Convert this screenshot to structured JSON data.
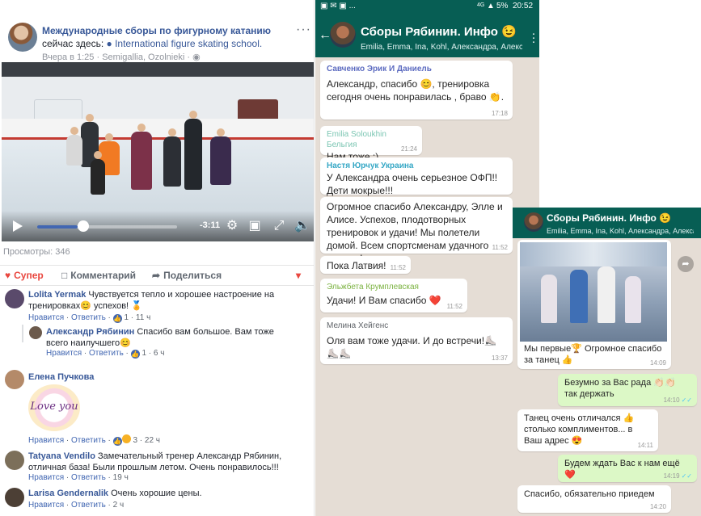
{
  "facebook": {
    "post": {
      "page_name": "Международные сборы по фигурному катанию",
      "time_inline": "сейчас",
      "here_prefix": "здесь:",
      "location": "International figure skating school.",
      "date": "Вчера в 1:25",
      "place": "Semigallia, Ozolnieki",
      "privacy_icon": "globe-icon"
    },
    "video": {
      "time_remaining": "-3:11",
      "progress": 0.29
    },
    "views": "Просмотры: 346",
    "actions": {
      "like": "Супер",
      "comment": "Комментарий",
      "share": "Поделиться"
    },
    "comments": [
      {
        "author": "Lolita Yermak",
        "text": "Чувствуется тепло и хорошее настроение на тренировках😊 успехов! 🏅",
        "reply": "Ответить",
        "likes": "1",
        "time": "11 ч",
        "reply_item": {
          "author": "Александр Рябинин",
          "text": "Спасибо вам большое. Вам тоже всего наилучшего😊",
          "like_label": "Нравится",
          "reply": "Ответить",
          "likes": "1",
          "time": "6 ч"
        }
      },
      {
        "author": "Елена Пучкова",
        "sticker_text": "Love you",
        "reply": "Ответить",
        "likes": "3",
        "time": "22 ч"
      },
      {
        "author": "Tatyana Vendilo",
        "text": "Замечательный тренер Александр Рябинин, отличная база! Были прошлым летом. Очень понравилось!!!",
        "reply": "Ответить",
        "time": "19 ч"
      },
      {
        "author": "Larisa Gendernalik",
        "text": "Очень хорошие цены.",
        "reply": "Ответить",
        "time": "2 ч"
      }
    ],
    "like_label": "Нравится"
  },
  "whatsapp_main": {
    "status": {
      "battery": "5%",
      "time": "20:52",
      "network": "4G"
    },
    "title": "Сборы Рябинин. Инфо 😉",
    "members": "Emilia, Emma, Ina, Kohl, Александра, Александр...",
    "messages": [
      {
        "sender": "Савченко Эрик И Даниель",
        "sender_color": "#5c6bc0",
        "text": "Александр, спасибо 😊, тренировка сегодня очень понравилась , браво 👏.",
        "time": "17:18"
      },
      {
        "sender": "Emilia Soloukhin Бельгия",
        "sender_color": "#7cc6b3",
        "text": "Нам тоже :)",
        "time": "21:24"
      },
      {
        "sender": "Настя Юрчук Украина",
        "sender_color": "#35a7c5",
        "text": "У Александра очень серьезное ОФП!! Дети мокрые!!!",
        "time": ""
      },
      {
        "sender": "",
        "sender_color": "",
        "text": "Огромное спасибо Александру, Элле и Алисе. Успехов, плодотворных тренировок и удачи! Мы полетели домой. Всем спортсменам удачного сезона !",
        "time": "11:52"
      },
      {
        "sender": "",
        "sender_color": "",
        "text": "Пока Латвия!",
        "time": "11:52"
      },
      {
        "sender": "Эльжбета Крумплевская",
        "sender_color": "#7cb342",
        "text": "Удачи! И Вам спасибо ❤️",
        "time": "11:52"
      },
      {
        "sender": "Мелина Хейгенс",
        "sender_color": "#5f6368",
        "text": "Оля вам тоже удачи. И до встречи!⛸️⛸️⛸️",
        "time": "13:37"
      }
    ]
  },
  "whatsapp_second": {
    "title": "Сборы Рябинин. Инфо 😉",
    "members": "Emilia, Emma, Ina, Kohl, Александра, Александр...",
    "messages": [
      {
        "dir": "in",
        "text": "Мы первые🏆 Огромное спасибо за танец 👍",
        "time": "14:09"
      },
      {
        "dir": "out",
        "text": "Безумно за Вас рада 👏🏻👏🏻 так держать",
        "time": "14:10"
      },
      {
        "dir": "in",
        "text": "Танец очень отличался 👍 столько комплиментов... в Ваш адрес 😍",
        "time": "14:11"
      },
      {
        "dir": "out",
        "text": "Будем ждать Вас к нам ещё ❤️",
        "time": "14:19"
      },
      {
        "dir": "in",
        "text": "Спасибо, обязательно приедем",
        "time": "14:20"
      }
    ]
  }
}
